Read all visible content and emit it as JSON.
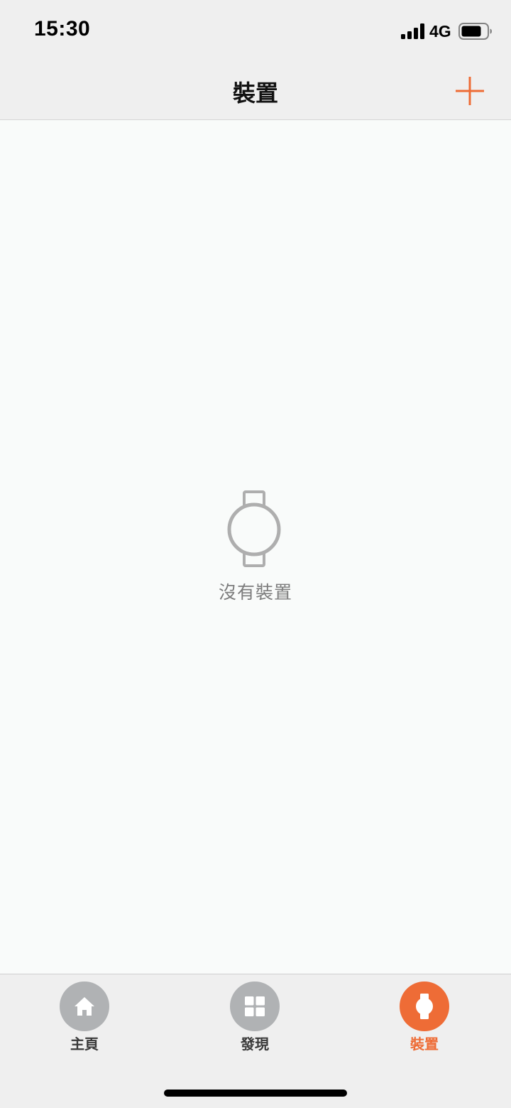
{
  "status_bar": {
    "time": "15:30",
    "network": "4G",
    "signal_icon": "cellular-signal-icon",
    "battery_icon": "battery-icon",
    "battery_level": 0.7
  },
  "nav": {
    "title": "裝置",
    "add_icon": "plus-icon"
  },
  "empty_state": {
    "icon": "watch-icon",
    "message": "沒有裝置"
  },
  "tabs": [
    {
      "label": "主頁",
      "icon": "home-icon",
      "active": false
    },
    {
      "label": "發現",
      "icon": "grid-icon",
      "active": false
    },
    {
      "label": "裝置",
      "icon": "watch-icon",
      "active": true
    }
  ],
  "colors": {
    "accent": "#ee6c36",
    "inactive_tab": "#b0b2b4",
    "bar_background": "#efefef",
    "content_background": "#f9fbfa",
    "muted_text": "#7c7c7c"
  }
}
